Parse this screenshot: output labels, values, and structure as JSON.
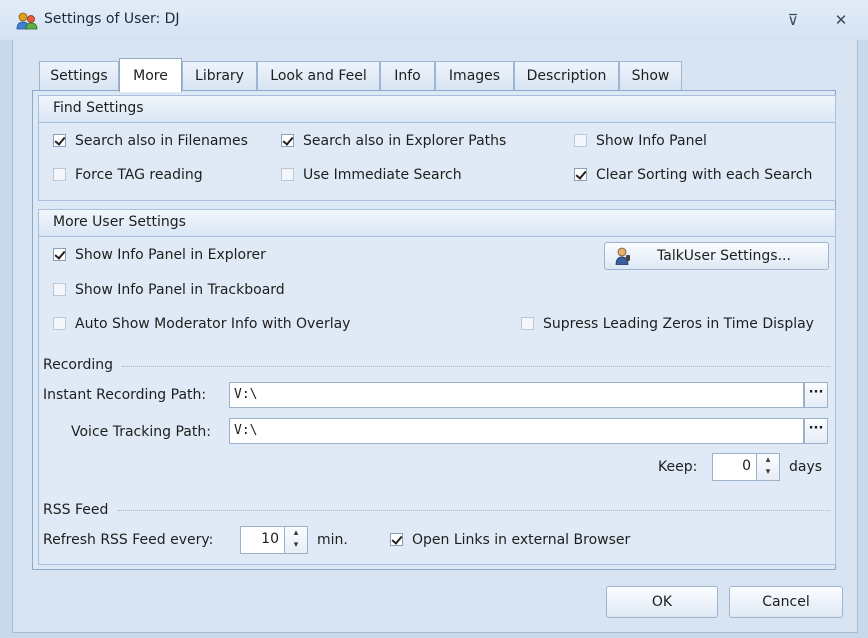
{
  "window": {
    "title": "Settings of User: DJ",
    "pin_glyph": "⊽",
    "close_glyph": "✕"
  },
  "tabs": [
    "Settings",
    "More",
    "Library",
    "Look and Feel",
    "Info",
    "Images",
    "Description",
    "Show"
  ],
  "active_tab": "More",
  "find_settings": {
    "header": "Find Settings",
    "options": [
      {
        "label": "Search also in Filenames",
        "checked": true
      },
      {
        "label": "Search also in Explorer Paths",
        "checked": true
      },
      {
        "label": "Show Info Panel",
        "checked": false
      },
      {
        "label": "Force TAG reading",
        "checked": false
      },
      {
        "label": "Use Immediate Search",
        "checked": false
      },
      {
        "label": "Clear Sorting with each Search",
        "checked": true
      }
    ]
  },
  "more_user_settings": {
    "header": "More User Settings",
    "options": [
      {
        "label": "Show Info Panel in Explorer",
        "checked": true
      },
      {
        "label": "Show Info Panel in Trackboard",
        "checked": false
      },
      {
        "label": "Auto Show Moderator Info with Overlay",
        "checked": false
      },
      {
        "label": "Supress Leading Zeros in Time Display",
        "checked": false
      }
    ],
    "talkuser_button": "TalkUser Settings...",
    "recording": {
      "label": "Recording",
      "instant_label": "Instant Recording Path:",
      "instant_value": "V:\\",
      "voice_label": "Voice Tracking Path:",
      "voice_value": "V:\\",
      "browse_label": "···",
      "keep_label": "Keep:",
      "keep_value": "0",
      "keep_unit": "days"
    },
    "rss": {
      "label": "RSS Feed",
      "refresh_label": "Refresh RSS Feed every:",
      "refresh_value": "10",
      "refresh_unit": "min.",
      "open_links_label": "Open Links in external Browser",
      "open_links_checked": true
    }
  },
  "spin_glyph": "▴\n▾",
  "buttons": {
    "ok": "OK",
    "cancel": "Cancel"
  },
  "icons": [
    "users-icon",
    "pin-icon",
    "close-icon",
    "user-talk-icon"
  ],
  "colors": {
    "background": "#c9d9ec",
    "panel": "#dde8f5",
    "border": "#8fa9c9"
  }
}
